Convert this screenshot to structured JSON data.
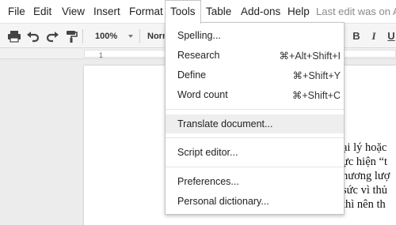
{
  "menubar": {
    "items": [
      {
        "label": "File"
      },
      {
        "label": "Edit"
      },
      {
        "label": "View"
      },
      {
        "label": "Insert"
      },
      {
        "label": "Format"
      },
      {
        "label": "Tools"
      },
      {
        "label": "Table"
      },
      {
        "label": "Add-ons"
      },
      {
        "label": "Help"
      }
    ],
    "active": "Tools",
    "last_edit": "Last edit was on A"
  },
  "toolbar": {
    "zoom": "100%",
    "style": "Normal",
    "bold": "B",
    "italic": "I",
    "underline": "U",
    "icons": [
      "print-icon",
      "undo-icon",
      "redo-icon",
      "paint-format-icon"
    ]
  },
  "ruler": {
    "marks": [
      "1"
    ]
  },
  "tools_menu": {
    "items": [
      {
        "label": "Spelling...",
        "shortcut": ""
      },
      {
        "label": "Research",
        "shortcut": "⌘+Alt+Shift+I"
      },
      {
        "label": "Define",
        "shortcut": "⌘+Shift+Y"
      },
      {
        "label": "Word count",
        "shortcut": "⌘+Shift+C"
      },
      {
        "label": "Translate document...",
        "shortcut": ""
      },
      {
        "label": "Script editor...",
        "shortcut": ""
      },
      {
        "label": "Preferences...",
        "shortcut": ""
      },
      {
        "label": "Personal dictionary...",
        "shortcut": ""
      }
    ],
    "highlighted": "Translate document..."
  },
  "document": {
    "lines": [
      "ại lý hoặc",
      "ực hiện “t",
      "hương lượ",
      "sức vì thủ",
      " thì nên th"
    ]
  }
}
